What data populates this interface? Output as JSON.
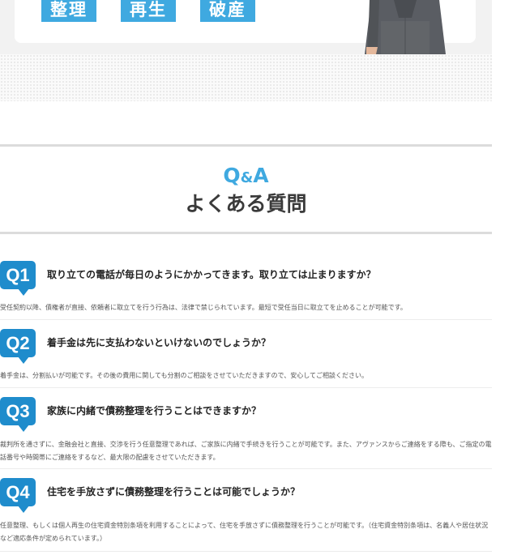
{
  "banner": {
    "tags": [
      "整理",
      "再生",
      "破産"
    ]
  },
  "section": {
    "title_en_q": "Q",
    "title_en_amp": "&",
    "title_en_a": "A",
    "title_ja": "よくある質問"
  },
  "faq": [
    {
      "badge": "Q1",
      "question": "取り立ての電話が毎日のようにかかってきます。取り立ては止まりますか？",
      "answer": "受任契約以降、債権者が直接、依頼者に取立てを行う行為は、法律で禁じられています。最短で受任当日に取立てを止めることが可能です。"
    },
    {
      "badge": "Q2",
      "question": "着手金は先に支払わないといけないのでしょうか？",
      "answer": "着手金は、分割払いが可能です。その後の費用に関しても分割のご相談をさせていただきますので、安心してご相談ください。"
    },
    {
      "badge": "Q3",
      "question": "家族に内緒で債務整理を行うことはできますか？",
      "answer": "裁判所を通さずに、金融会社と直接、交渉を行う任意整理であれば、ご家族に内緒で手続きを行うことが可能です。また、アヴァンスからご連絡をする際も、ご指定の電話番号や時間帯にご連絡をするなど、最大限の配慮をさせていただきます。"
    },
    {
      "badge": "Q4",
      "question": "住宅を手放さずに債務整理を行うことは可能でしょうか？",
      "answer": "任意整理、もしくは個人再生の住宅資金特別条項を利用することによって、住宅を手放さずに債務整理を行うことが可能です。（住宅資金特別条項は、名義人や居住状況など適応条件が定められています。）"
    }
  ]
}
